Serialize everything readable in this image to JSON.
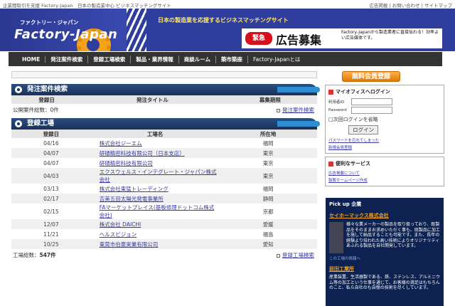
{
  "top": {
    "tagline": "企業間取引を支援 Factory-Japan　日本の製造業中心 ビジネスマッチングサイト",
    "links": "広告掲載 | お問い合わせ | サイトマップ"
  },
  "header": {
    "logo_sub": "ファクトリー・ジャパン",
    "logo_main": "Factory-Japan",
    "tagline": "日本の製造業を応援するビジネスマッチングサイト",
    "ad_urgent": "緊急",
    "ad_title": "広告募集",
    "ad_desc": "Factory-Japanから製造業者に直接伝わる！効率よい広告媒体です。"
  },
  "nav": [
    "HOME",
    "発注案件検索",
    "登録工場検索",
    "製品・業界情報",
    "商談ルーム",
    "築市築座",
    "Factory-Japanとは"
  ],
  "orders": {
    "title": "発注案件検索",
    "headers": [
      "登録日",
      "発注タイトル",
      "募集期限"
    ],
    "count_label": "公開案件総数：0件",
    "search_link": "発注案件検索"
  },
  "factories": {
    "title": "登録工場",
    "headers": [
      "登録日",
      "工場名",
      "所在地"
    ],
    "rows": [
      {
        "date": "04/16",
        "name": "株式会社ジーエム",
        "loc": "福岡"
      },
      {
        "date": "04/07",
        "name": "研碩精密科技有限公司（日本支店）",
        "loc": "東京"
      },
      {
        "date": "04/07",
        "name": "研碩精密科技有限公司",
        "loc": "東京"
      },
      {
        "date": "04/03",
        "name": "エクスウェルス・インテグレート・ジャパン株式会社",
        "loc": "東京"
      },
      {
        "date": "03/13",
        "name": "株式会社東猛トレーディング",
        "loc": "福岡"
      },
      {
        "date": "02/17",
        "name": "吉美五田太陽光発電事業所",
        "loc": "静岡"
      },
      {
        "date": "02/15",
        "name": "FAマーケットプレイス(基板修理ドットコム株式会社)",
        "loc": "京都"
      },
      {
        "date": "12/07",
        "name": "株式会社 DAICHI",
        "loc": "愛媛"
      },
      {
        "date": "11/21",
        "name": "ヘルスビジョン",
        "loc": "福島"
      },
      {
        "date": "10/25",
        "name": "東莞市伯豪実業有限公司",
        "loc": "愛知"
      }
    ],
    "count_label": "工場総数：",
    "count_value": "547件",
    "search_link": "登録工場検索"
  },
  "side": {
    "reg_btn": "無料会員登録",
    "login_title": "マイオフィスへログイン",
    "id_label": "利用者ID",
    "pw_label": "Password",
    "remember": "次回ログインを省略",
    "login_btn": "ログイン",
    "forgot": "パスワードを忘れてしまった",
    "new_reg": "新規会員登録",
    "service_title": "便利なサービス",
    "svc1": "広告掲載について",
    "svc2": "製販ホームページ作成",
    "pick_title": "Pick up 企業",
    "pick_co": "セイホーマックス株式会社",
    "pick_text": "様々な業メーカーの製品を取り扱っており、既製品をそのままお求めいただく事も、既製品に加工を施して納品することも可能です。また、長年の経験より培われた高い技術によりオリジナリティあふれる製品を自社開発しています。",
    "pick_link": "この工場の情報へ",
    "pick_co2": "前田工業所",
    "pick_text2": "産業装置、生活器製である、鉄、ステンレス、アルミニウム等の加工という仕事を通じて、お客様の満足はもちろんのこと、私ら自社のも自慢の技術を尽くしています。"
  }
}
